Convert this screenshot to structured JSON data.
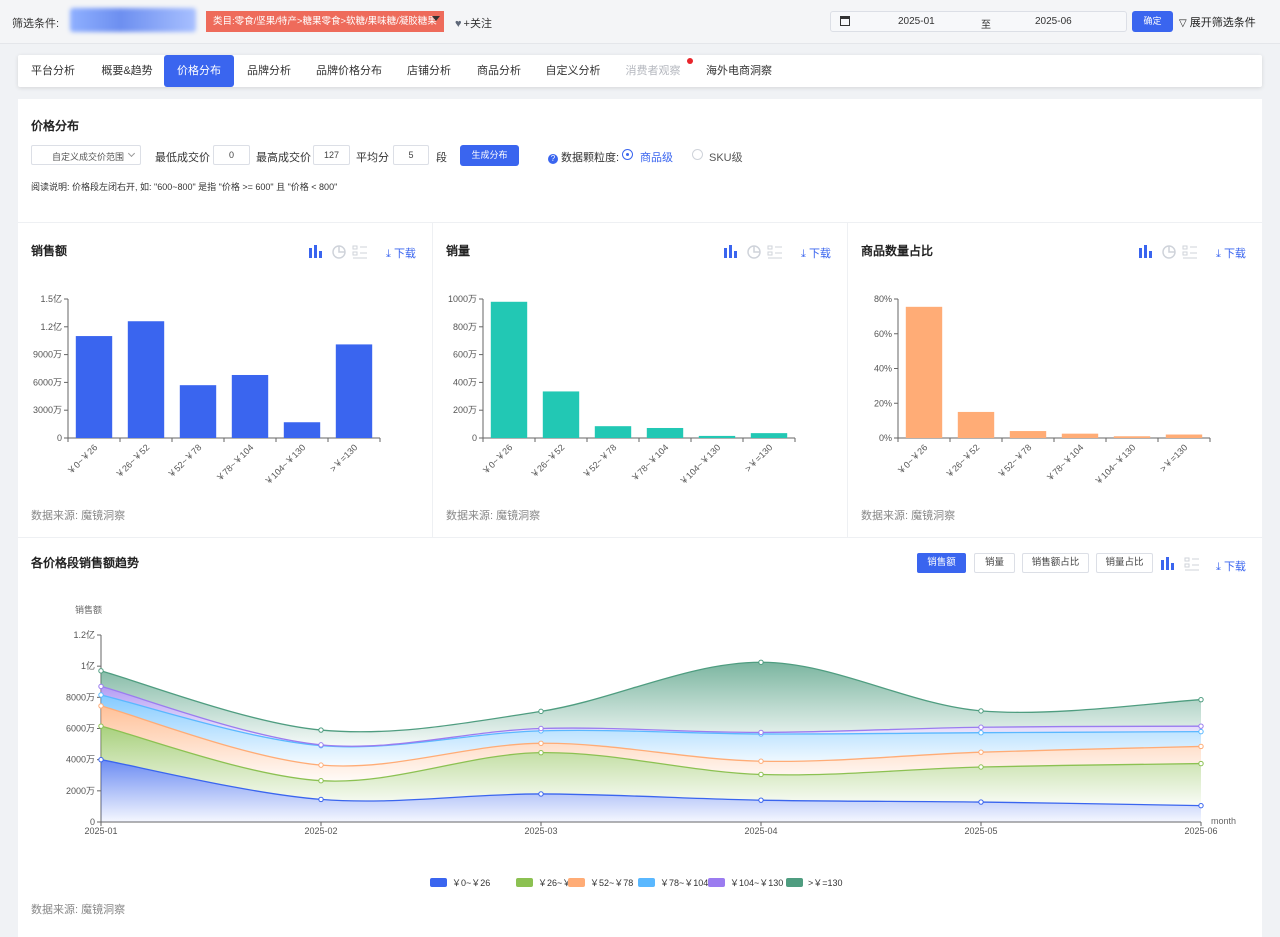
{
  "filter": {
    "label": "筛选条件:",
    "category": "类目:零食/坚果/特产>糖果零食>软糖/果味糖/凝胶糖果",
    "follow": "+关注",
    "date_start": "2025-01",
    "date_to": "至",
    "date_end": "2025-06",
    "confirm": "确定",
    "expand": "展开筛选条件"
  },
  "tabs": [
    {
      "label": "平台分析"
    },
    {
      "label": "概要&趋势"
    },
    {
      "label": "价格分布"
    },
    {
      "label": "品牌分析"
    },
    {
      "label": "品牌价格分布"
    },
    {
      "label": "店铺分析"
    },
    {
      "label": "商品分析"
    },
    {
      "label": "自定义分析"
    },
    {
      "label": "消费者观察"
    },
    {
      "label": "海外电商洞察"
    }
  ],
  "controls": {
    "title": "价格分布",
    "range_select": "自定义成交价范围",
    "min_label": "最低成交价",
    "min_value": "0",
    "max_label": "最高成交价",
    "max_value": "127",
    "avg_label": "平均分",
    "segments": "5",
    "seg_unit": "段",
    "generate": "生成分布",
    "granularity_label": "数据颗粒度:",
    "opt_product": "商品级",
    "opt_sku": "SKU级",
    "note": "阅读说明: 价格段左闭右开, 如: \"600~800\" 是指 \"价格 >= 600\" 且 \"价格 < 800\""
  },
  "common": {
    "download": "下载",
    "source": "数据来源: 魔镜洞察"
  },
  "colors": {
    "accent": "#3a65ef",
    "sales": "#3a65ef",
    "volume": "#22c8b4",
    "share": "#ffac76"
  },
  "trend": {
    "title": "各价格段销售额趋势",
    "buttons": [
      "销售额",
      "销量",
      "销售额占比",
      "销量占比"
    ]
  },
  "chart_data": [
    {
      "type": "bar",
      "title": "销售额",
      "categories": [
        "￥0~￥26",
        "￥26~￥52",
        "￥52~￥78",
        "￥78~￥104",
        "￥104~￥130",
        ">￥=130"
      ],
      "values": [
        110000000,
        126000000,
        57000000,
        68000000,
        17000000,
        101000000
      ],
      "ylim": [
        0,
        150000000
      ],
      "yticks": [
        "0",
        "3000万",
        "6000万",
        "9000万",
        "1.2亿",
        "1.5亿"
      ],
      "color": "#3a65ef"
    },
    {
      "type": "bar",
      "title": "销量",
      "categories": [
        "￥0~￥26",
        "￥26~￥52",
        "￥52~￥78",
        "￥78~￥104",
        "￥104~￥130",
        ">￥=130"
      ],
      "values": [
        9800000,
        3350000,
        850000,
        720000,
        150000,
        350000
      ],
      "ylim": [
        0,
        10000000
      ],
      "yticks": [
        "0",
        "200万",
        "400万",
        "600万",
        "800万",
        "1000万"
      ],
      "color": "#22c8b4"
    },
    {
      "type": "bar",
      "title": "商品数量占比",
      "categories": [
        "￥0~￥26",
        "￥26~￥52",
        "￥52~￥78",
        "￥78~￥104",
        "￥104~￥130",
        ">￥=130"
      ],
      "values": [
        75.5,
        15.0,
        4.0,
        2.5,
        1.0,
        2.0
      ],
      "ylim": [
        0,
        80
      ],
      "yticks": [
        "0%",
        "20%",
        "40%",
        "60%",
        "80%"
      ],
      "color": "#ffac76"
    },
    {
      "type": "area",
      "stacked": true,
      "ylabel": "销售额",
      "xlabel": "month",
      "x": [
        "2025-01",
        "2025-02",
        "2025-03",
        "2025-04",
        "2025-05",
        "2025-06"
      ],
      "ylim": [
        0,
        120000000
      ],
      "yticks": [
        "0",
        "2000万",
        "4000万",
        "6000万",
        "8000万",
        "1亿",
        "1.2亿"
      ],
      "series": [
        {
          "name": "￥0~￥26",
          "color": "#3a65ef",
          "values": [
            40000000,
            14500000,
            18000000,
            14000000,
            12800000,
            10500000
          ]
        },
        {
          "name": "￥26~￥52",
          "color": "#8cc152",
          "values": [
            21500000,
            12000000,
            26500000,
            16500000,
            22500000,
            27000000
          ]
        },
        {
          "name": "￥52~￥78",
          "color": "#ffac76",
          "values": [
            13000000,
            10000000,
            6000000,
            8500000,
            9500000,
            11000000
          ]
        },
        {
          "name": "￥78~￥104",
          "color": "#5ab8ff",
          "values": [
            7000000,
            12500000,
            8000000,
            17500000,
            12500000,
            9500000
          ]
        },
        {
          "name": "￥104~￥130",
          "color": "#9b7cf0",
          "values": [
            5500000,
            500000,
            1500000,
            1000000,
            3500000,
            3500000
          ]
        },
        {
          "name": ">￥=130",
          "color": "#4f9d80",
          "values": [
            10000000,
            9500000,
            11000000,
            45000000,
            10500000,
            17000000
          ]
        }
      ]
    }
  ]
}
